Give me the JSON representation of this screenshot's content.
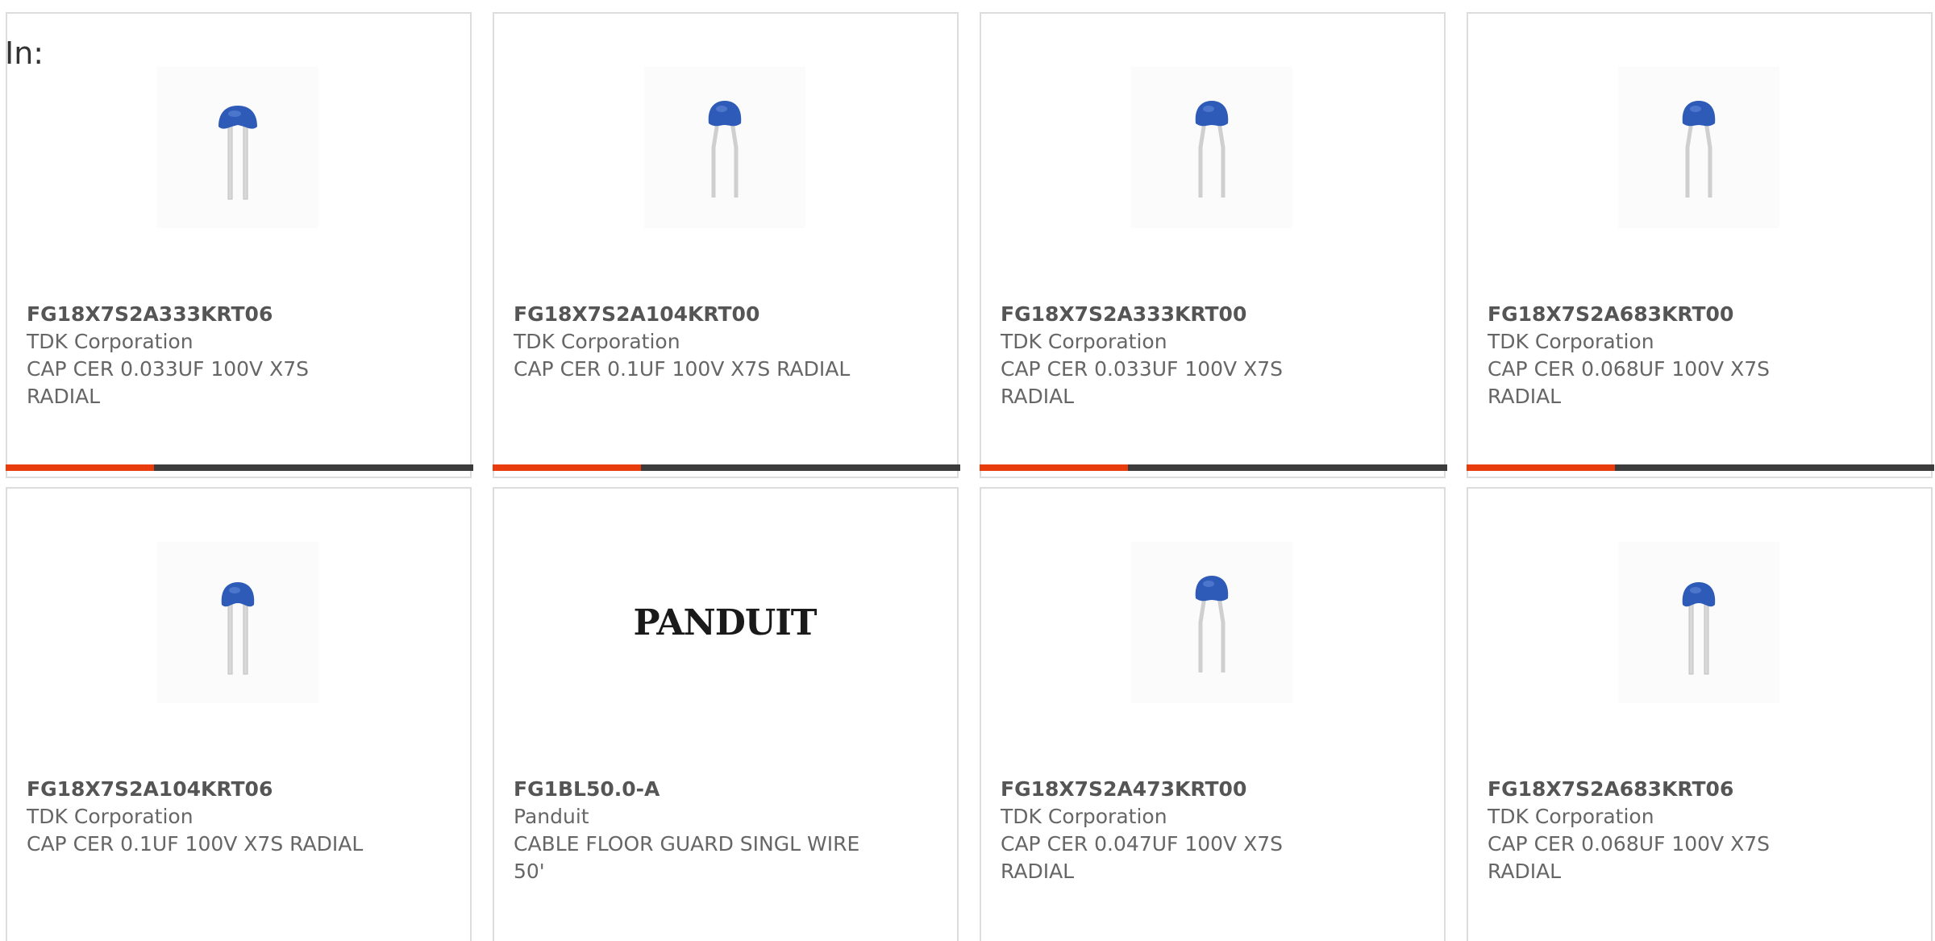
{
  "search": {
    "label": "In:"
  },
  "products": [
    {
      "part_number": "FG18X7S2A333KRT06",
      "manufacturer": "TDK Corporation",
      "description": "CAP CER 0.033UF 100V X7S RADIAL",
      "image": "capacitor-straight-leads-icon",
      "progress": 0.31
    },
    {
      "part_number": "FG18X7S2A104KRT00",
      "manufacturer": "TDK Corporation",
      "description": "CAP CER 0.1UF 100V X7S RADIAL",
      "image": "capacitor-kinked-leads-icon",
      "progress": 0.31
    },
    {
      "part_number": "FG18X7S2A333KRT00",
      "manufacturer": "TDK Corporation",
      "description": "CAP CER 0.033UF 100V X7S RADIAL",
      "image": "capacitor-kinked-leads-icon",
      "progress": 0.31
    },
    {
      "part_number": "FG18X7S2A683KRT00",
      "manufacturer": "TDK Corporation",
      "description": "CAP CER 0.068UF 100V X7S RADIAL",
      "image": "capacitor-kinked-leads-icon",
      "progress": 0.31
    },
    {
      "part_number": "FG18X7S2A104KRT06",
      "manufacturer": "TDK Corporation",
      "description": "CAP CER 0.1UF 100V X7S RADIAL",
      "image": "capacitor-straight-leads-icon"
    },
    {
      "part_number": "FG1BL50.0-A",
      "manufacturer": "Panduit",
      "description": "CABLE FLOOR GUARD SINGL WIRE 50'",
      "image": "panduit-logo",
      "logo_text": "PANDUIT"
    },
    {
      "part_number": "FG18X7S2A473KRT00",
      "manufacturer": "TDK Corporation",
      "description": "CAP CER 0.047UF 100V X7S RADIAL",
      "image": "capacitor-kinked-leads-icon"
    },
    {
      "part_number": "FG18X7S2A683KRT06",
      "manufacturer": "TDK Corporation",
      "description": "CAP CER 0.068UF 100V X7S RADIAL",
      "image": "capacitor-straight-leads-icon"
    }
  ],
  "colors": {
    "accent": "#e83c0c",
    "bar_track": "#3c3c3c",
    "capacitor_body": "#2e5bb8",
    "text_bold": "#555555",
    "text_regular": "#666666",
    "border": "#dcdcdc"
  }
}
